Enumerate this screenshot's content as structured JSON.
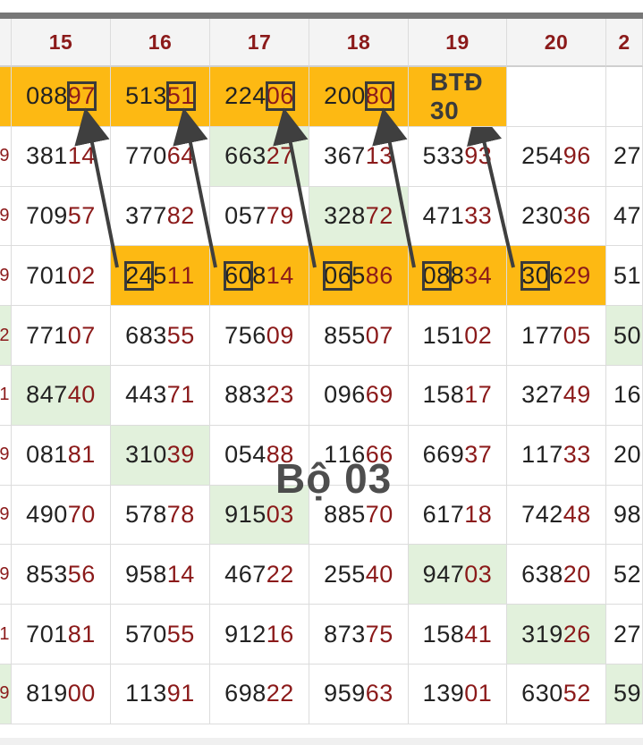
{
  "headers": [
    "",
    "15",
    "16",
    "17",
    "18",
    "19",
    "20",
    "2"
  ],
  "rows": [
    [
      {
        "t": "",
        "bg": "hl"
      },
      {
        "t": "08897",
        "bg": "hl",
        "tail": [
          3,
          5
        ],
        "box": [
          3,
          5
        ]
      },
      {
        "t": "51351",
        "bg": "hl",
        "tail": [
          3,
          5
        ],
        "box": [
          3,
          5
        ]
      },
      {
        "t": "22406",
        "bg": "hl",
        "tail": [
          3,
          5
        ],
        "box": [
          3,
          5
        ]
      },
      {
        "t": "20080",
        "bg": "hl",
        "tail": [
          3,
          5
        ],
        "box": [
          3,
          5
        ]
      },
      {
        "t": "BTĐ 30",
        "bg": "hl",
        "btd": true
      },
      {
        "t": ""
      },
      {
        "t": ""
      }
    ],
    [
      {
        "t": "9"
      },
      {
        "t": "38114"
      },
      {
        "t": "77064"
      },
      {
        "t": "66327",
        "bg": "gr"
      },
      {
        "t": "36713"
      },
      {
        "t": "53393"
      },
      {
        "t": "25496"
      },
      {
        "t": "27"
      }
    ],
    [
      {
        "t": "9"
      },
      {
        "t": "70957"
      },
      {
        "t": "37782"
      },
      {
        "t": "05779"
      },
      {
        "t": "32872",
        "bg": "gr"
      },
      {
        "t": "47133"
      },
      {
        "t": "23036"
      },
      {
        "t": "47"
      }
    ],
    [
      {
        "t": "9"
      },
      {
        "t": "70102"
      },
      {
        "t": "24511",
        "bg": "hl",
        "box": [
          0,
          2
        ]
      },
      {
        "t": "60814",
        "bg": "hl",
        "box": [
          0,
          2
        ]
      },
      {
        "t": "06586",
        "bg": "hl",
        "box": [
          0,
          2
        ]
      },
      {
        "t": "08834",
        "bg": "hl",
        "box": [
          0,
          2
        ]
      },
      {
        "t": "30629",
        "bg": "hl",
        "box": [
          0,
          2
        ]
      },
      {
        "t": "51"
      }
    ],
    [
      {
        "t": "2",
        "bg": "gr"
      },
      {
        "t": "77107"
      },
      {
        "t": "68355"
      },
      {
        "t": "75609"
      },
      {
        "t": "85507"
      },
      {
        "t": "15102"
      },
      {
        "t": "17705"
      },
      {
        "t": "50",
        "bg": "gr"
      }
    ],
    [
      {
        "t": "1"
      },
      {
        "t": "84740",
        "bg": "gr"
      },
      {
        "t": "44371"
      },
      {
        "t": "88323"
      },
      {
        "t": "09669"
      },
      {
        "t": "15817"
      },
      {
        "t": "32749"
      },
      {
        "t": "16"
      }
    ],
    [
      {
        "t": "9"
      },
      {
        "t": "08181"
      },
      {
        "t": "31039",
        "bg": "gr"
      },
      {
        "t": "05488"
      },
      {
        "t": "11666"
      },
      {
        "t": "66937"
      },
      {
        "t": "11733"
      },
      {
        "t": "20"
      }
    ],
    [
      {
        "t": "9"
      },
      {
        "t": "49070"
      },
      {
        "t": "57878"
      },
      {
        "t": "91503",
        "bg": "gr"
      },
      {
        "t": "88570"
      },
      {
        "t": "61718"
      },
      {
        "t": "74248"
      },
      {
        "t": "98"
      }
    ],
    [
      {
        "t": "9"
      },
      {
        "t": "85356"
      },
      {
        "t": "95814"
      },
      {
        "t": "46722"
      },
      {
        "t": "25540"
      },
      {
        "t": "94703",
        "bg": "gr"
      },
      {
        "t": "63820"
      },
      {
        "t": "52"
      }
    ],
    [
      {
        "t": "1"
      },
      {
        "t": "70181"
      },
      {
        "t": "57055"
      },
      {
        "t": "91216"
      },
      {
        "t": "87375"
      },
      {
        "t": "15841"
      },
      {
        "t": "31926",
        "bg": "gr"
      },
      {
        "t": "27"
      }
    ],
    [
      {
        "t": "9",
        "bg": "gr"
      },
      {
        "t": "81900"
      },
      {
        "t": "11391"
      },
      {
        "t": "69822"
      },
      {
        "t": "95963"
      },
      {
        "t": "13901"
      },
      {
        "t": "63052"
      },
      {
        "t": "59",
        "bg": "gr"
      }
    ]
  ],
  "watermark": "Bộ 03",
  "colors": {
    "highlight": "#fdb913",
    "green": "#e2f1dc",
    "number_red": "#8b1a1a",
    "arrow": "#3f3f3f"
  }
}
